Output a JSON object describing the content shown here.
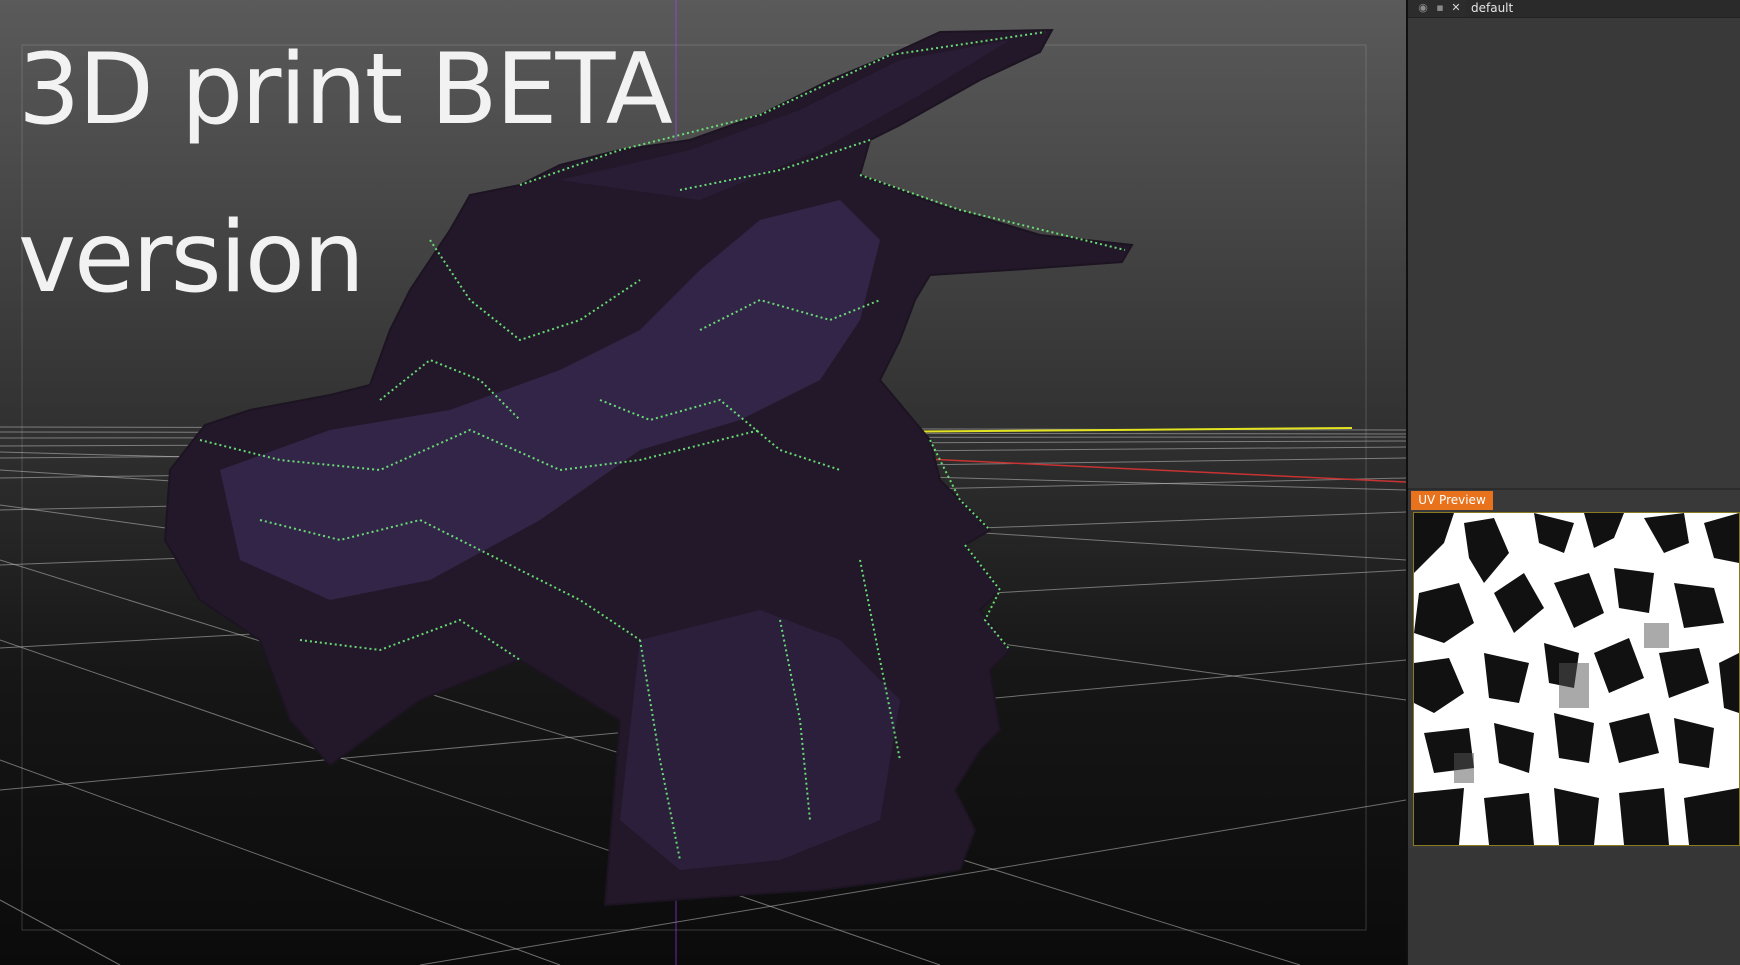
{
  "viewport": {
    "overlay_title": "3D print BETA\nversion",
    "grid_colors": {
      "lines": "#cfcfcf",
      "x_axis": "#c83232",
      "y_axis": "#d8d820",
      "z_axis": "#b040ff"
    },
    "model_colors": {
      "body": "#22182a",
      "body_shade": "#3a2a52",
      "points": "#6ef07a"
    }
  },
  "layers_panel": {
    "icons": [
      "eye-icon",
      "lock-icon",
      "close-icon"
    ],
    "layer_name": "default"
  },
  "uv_preview": {
    "tab_label": "UV Preview",
    "accent_color": "#e8731c"
  }
}
